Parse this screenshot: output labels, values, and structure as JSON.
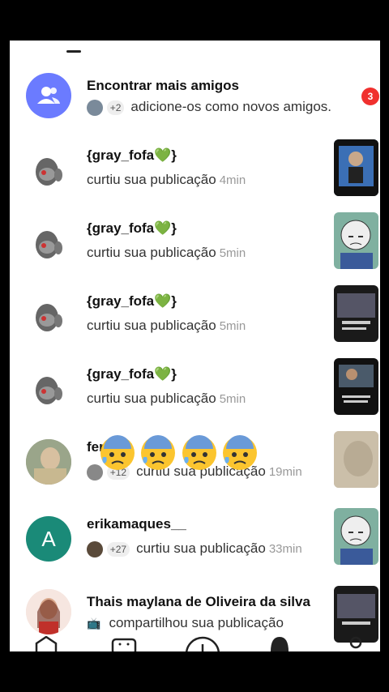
{
  "find_friends": {
    "title": "Encontrar mais amigos",
    "count": "+2",
    "subtitle": "adicione-os como novos amigos.",
    "badge": "3"
  },
  "notifications": [
    {
      "name": "{gray_fofa💚}",
      "action": "curtiu sua publicação",
      "time": "4min"
    },
    {
      "name": "{gray_fofa💚}",
      "action": "curtiu sua publicação",
      "time": "5min"
    },
    {
      "name": "{gray_fofa💚}",
      "action": "curtiu sua publicação",
      "time": "5min"
    },
    {
      "name": "{gray_fofa💚}",
      "action": "curtiu sua publicação",
      "time": "5min"
    },
    {
      "name": "fer",
      "count": "+12",
      "action": "curtiu sua publicação",
      "time": "19min"
    },
    {
      "name": "erikamaques__",
      "avatar_letter": "A",
      "count": "+27",
      "action": "curtiu sua publicação",
      "time": "33min"
    },
    {
      "name": "Thais maylana de Oliveira da silva",
      "action": "compartilhou sua publicação"
    }
  ],
  "colors": {
    "friends_icon_bg": "#6b7bff",
    "badge": "#f0302e",
    "erika_avatar": "#1a8a78"
  }
}
